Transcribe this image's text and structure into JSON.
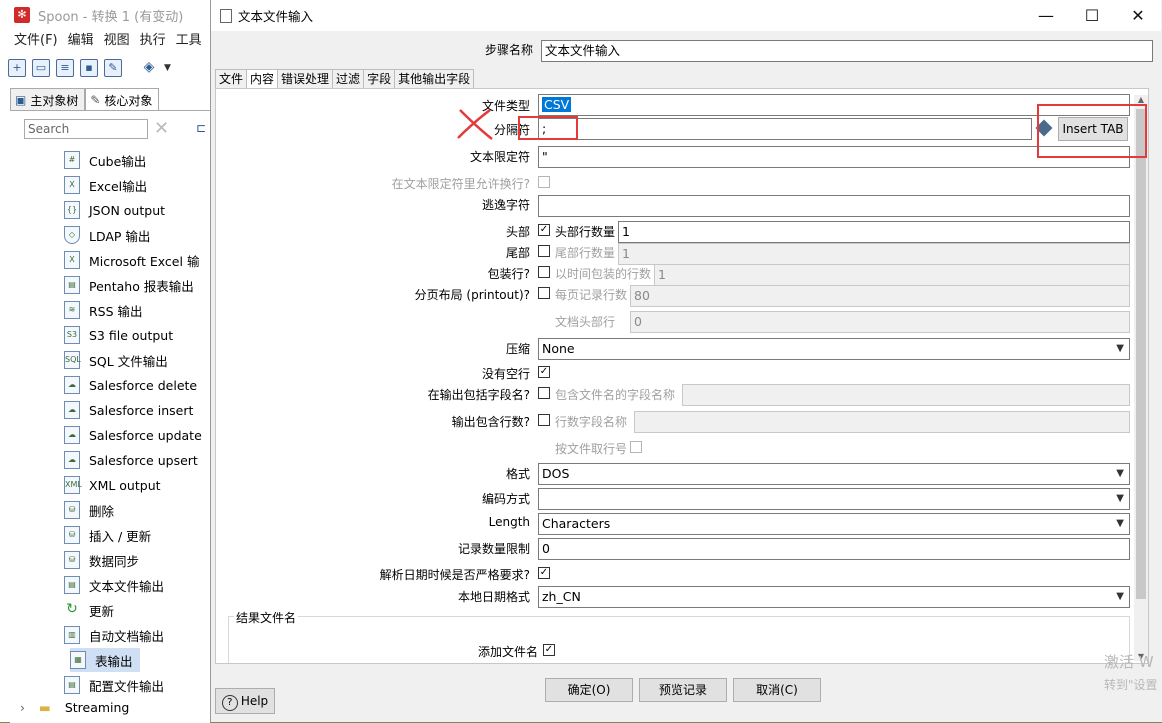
{
  "spoon": {
    "title": "Spoon - 转换 1 (有变动)",
    "menu": [
      "文件(F)",
      "编辑",
      "视图",
      "执行",
      "工具"
    ],
    "tabs": [
      "主对象树",
      "核心对象"
    ],
    "search_placeholder": "Search",
    "tree_items": [
      "Cube输出",
      "Excel输出",
      "JSON output",
      "LDAP 输出",
      "Microsoft Excel 输",
      "Pentaho 报表输出",
      "RSS 输出",
      "S3 file output",
      "SQL 文件输出",
      "Salesforce delete",
      "Salesforce insert",
      "Salesforce update",
      "Salesforce upsert",
      "XML output",
      "删除",
      "插入 / 更新",
      "数据同步",
      "文本文件输出",
      "更新",
      "自动文档输出",
      "表输出",
      "配置文件输出"
    ],
    "selected_item": "表输出",
    "group_label": "Streaming"
  },
  "dialog": {
    "title": "文本文件输入",
    "window_buttons": [
      "—",
      "☐",
      "✕"
    ],
    "step_name_label": "步骤名称",
    "step_name_value": "文本文件输入",
    "tabs": [
      "文件",
      "内容",
      "错误处理",
      "过滤",
      "字段",
      "其他输出字段"
    ],
    "active_tab": "内容",
    "fields": {
      "file_type_label": "文件类型",
      "file_type_value": "CSV",
      "separator_label": "分隔符",
      "separator_value": ";",
      "insert_tab_label": "Insert TAB",
      "enclosure_label": "文本限定符",
      "enclosure_value": "\"",
      "allow_breaks_label": "在文本限定符里允许换行?",
      "escape_label": "逃逸字符",
      "escape_value": "",
      "header_label": "头部",
      "header_checked": true,
      "header_lines_label": "头部行数量",
      "header_lines_value": "1",
      "footer_label": "尾部",
      "footer_lines_label": "尾部行数量",
      "footer_lines_value": "1",
      "wrap_label": "包装行?",
      "wrap_lines_label": "以时间包装的行数",
      "wrap_lines_value": "1",
      "paged_label": "分页布局 (printout)?",
      "page_lines_label": "每页记录行数",
      "page_lines_value": "80",
      "doc_header_label": "文档头部行",
      "doc_header_value": "0",
      "compression_label": "压缩",
      "compression_value": "None",
      "no_empty_label": "没有空行",
      "no_empty_checked": true,
      "include_filename_label": "在输出包括字段名?",
      "filename_field_label": "包含文件名的字段名称",
      "include_rownum_label": "输出包含行数?",
      "rownum_field_label": "行数字段名称",
      "rownum_by_file_label": "按文件取行号",
      "format_label": "格式",
      "format_value": "DOS",
      "encoding_label": "编码方式",
      "encoding_value": "",
      "length_label": "Length",
      "length_value": "Characters",
      "limit_label": "记录数量限制",
      "limit_value": "0",
      "lenient_label": "解析日期时候是否严格要求?",
      "lenient_checked": true,
      "locale_label": "本地日期格式",
      "locale_value": "zh_CN",
      "result_group_label": "结果文件名",
      "add_filename_label": "添加文件名",
      "add_filename_checked": true
    },
    "buttons": {
      "ok": "确定(O)",
      "preview": "预览记录",
      "cancel": "取消(C)",
      "help": "Help"
    },
    "check_mark": "✓"
  },
  "watermark": {
    "line1": "激活 W",
    "line2": "转到\"设置"
  },
  "annotation_color": "#e33b3b"
}
